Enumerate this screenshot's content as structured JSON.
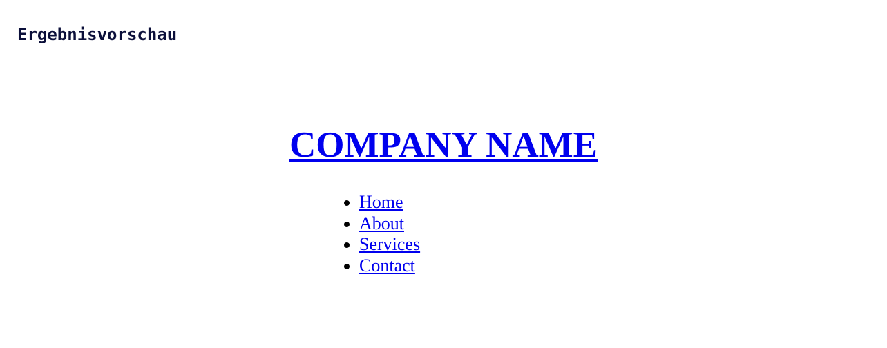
{
  "preview": {
    "heading": "Ergebnisvorschau"
  },
  "site": {
    "company_name": "COMPANY NAME",
    "nav": [
      {
        "label": "Home"
      },
      {
        "label": "About"
      },
      {
        "label": "Services"
      },
      {
        "label": "Contact"
      }
    ]
  },
  "colors": {
    "link": "#0000ee",
    "heading": "#0b0f3a",
    "background": "#ffffff"
  }
}
